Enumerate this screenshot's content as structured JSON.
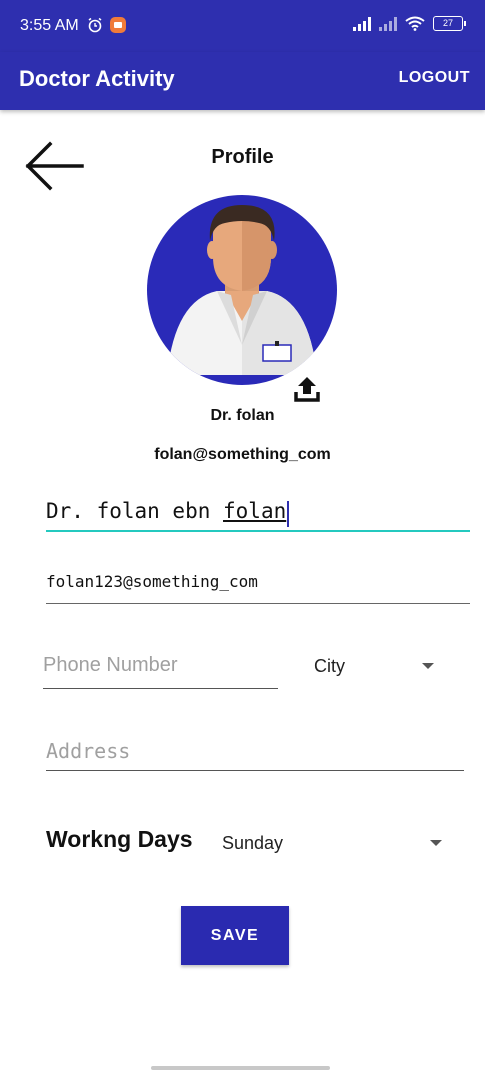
{
  "status_bar": {
    "time": "3:55 AM",
    "battery": "27",
    "icons": [
      "alarm-icon",
      "screen-record-icon",
      "signal-icon",
      "wifi-icon",
      "battery-icon"
    ]
  },
  "app_bar": {
    "title": "Doctor Activity",
    "logout_label": "LOGOUT",
    "color": "#2e2faf"
  },
  "profile": {
    "page_title": "Profile",
    "display_name": "Dr. folan",
    "display_email": "folan@something_com"
  },
  "form": {
    "name_value_plain": "Dr. folan ebn ",
    "name_value_underlined": "folan",
    "email_value": "folan123@something_com",
    "phone_placeholder": "Phone Number",
    "city_selected": "City",
    "address_placeholder": "Address",
    "working_days_label": "Workng Days",
    "working_day_selected": "Sunday",
    "save_label": "SAVE",
    "accent_color": "#24c9bf",
    "button_color": "#2a2ab0"
  }
}
